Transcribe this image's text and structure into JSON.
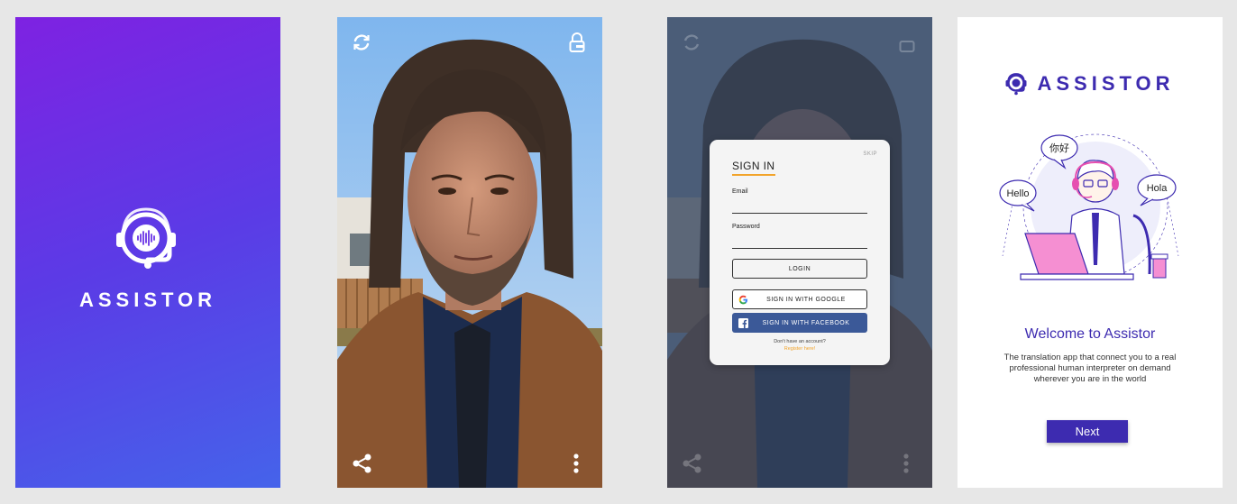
{
  "splash": {
    "brand_name": "ASSISTOR",
    "gradient_colors": [
      "#7e22e2",
      "#4563ea"
    ],
    "logo_icon": "headset-soundwave-icon"
  },
  "camera": {
    "top_left_icon": "refresh-icon",
    "top_right_icon": "lock-icon",
    "bottom_left_icon": "share-icon",
    "bottom_right_icon": "more-vertical-icon"
  },
  "signin": {
    "skip_label": "SKIP",
    "title": "SIGN IN",
    "email_label": "Email",
    "email_value": "",
    "password_label": "Password",
    "password_value": "",
    "login_label": "LOGIN",
    "google_label": "SIGN IN WITH GOOGLE",
    "facebook_label": "SIGN IN WITH FACEBOOK",
    "no_account_text": "Don't have an account?",
    "register_link": "Register here!",
    "accent_color": "#f2a42b",
    "facebook_color": "#3b5998"
  },
  "welcome": {
    "brand_name": "ASSISTOR",
    "bubbles": [
      "你好",
      "Hello",
      "Hola"
    ],
    "title": "Welcome to Assistor",
    "description": "The translation app that connect you to a real professional human interpreter on demand wherever you are in the world",
    "next_label": "Next",
    "brand_color": "#3d2bb0"
  }
}
